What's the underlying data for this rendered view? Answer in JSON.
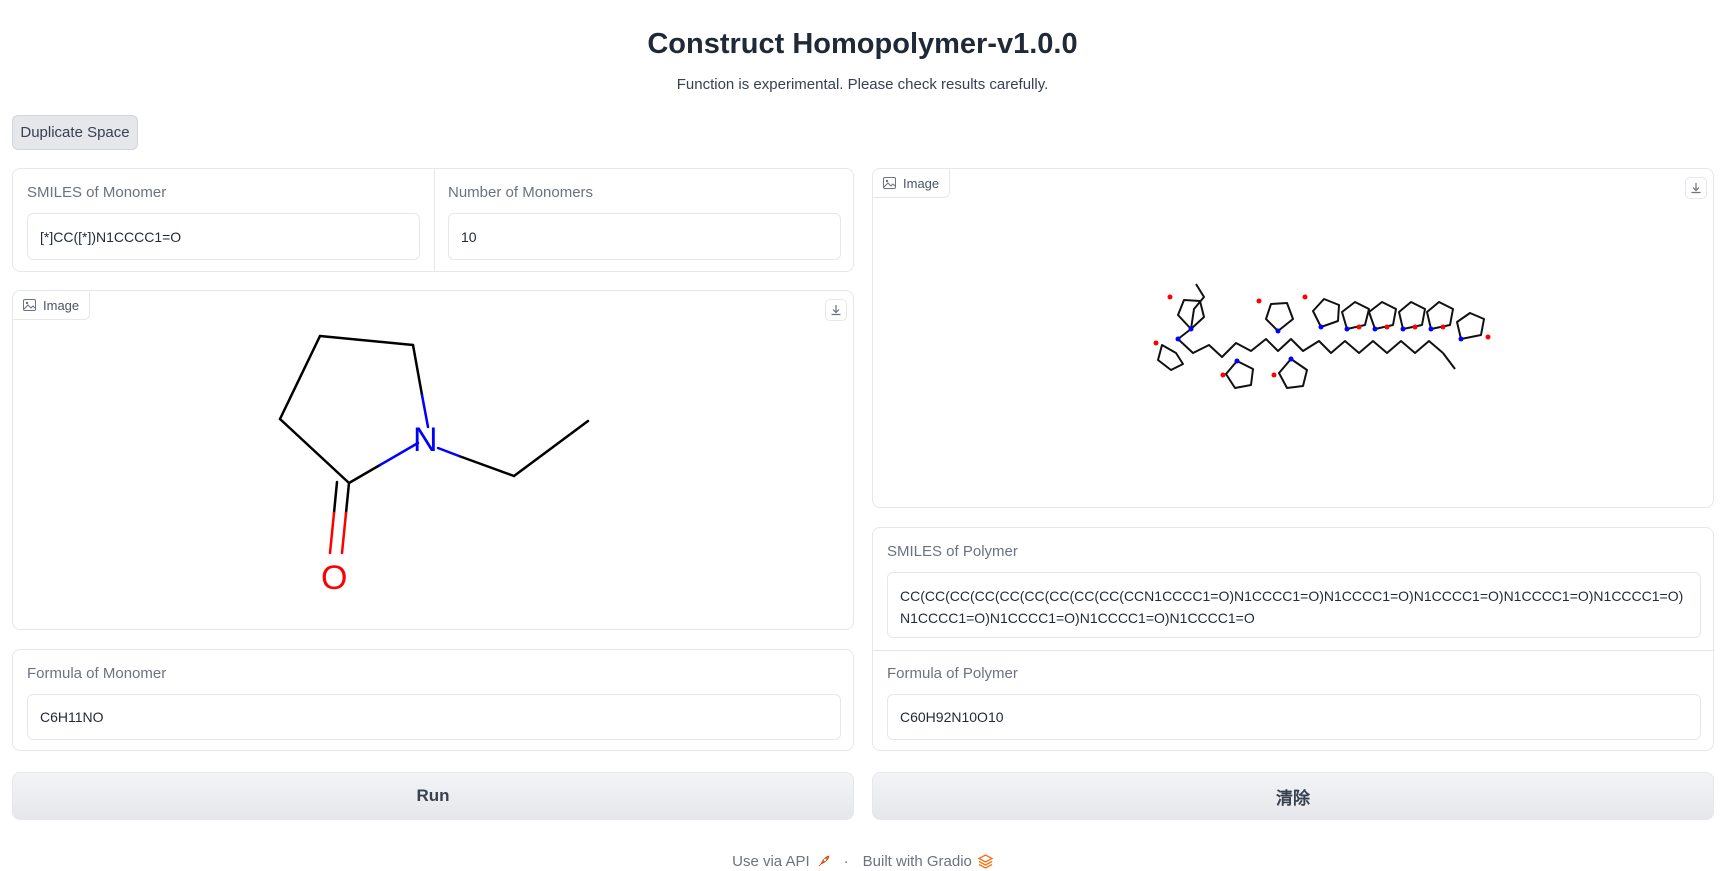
{
  "header": {
    "title": "Construct Homopolymer-v1.0.0",
    "subtitle": "Function is experimental. Please check results carefully."
  },
  "duplicate_button": "Duplicate Space",
  "monomer": {
    "smiles_label": "SMILES of Monomer",
    "smiles_value": "[*]CC([*])N1CCCC1=O",
    "count_label": "Number of Monomers",
    "count_value": "10",
    "image_label": "Image",
    "atom_n": "N",
    "atom_o": "O",
    "formula_label": "Formula of Monomer",
    "formula_value": "C6H11NO"
  },
  "polymer": {
    "image_label": "Image",
    "smiles_label": "SMILES of Polymer",
    "smiles_value": "CC(CC(CC(CC(CC(CC(CC(CC(CC(CCN1CCCC1=O)N1CCCC1=O)N1CCCC1=O)N1CCCC1=O)N1CCCC1=O)N1CCCC1=O)N1CCCC1=O)N1CCCC1=O)N1CCCC1=O)N1CCCC1=O",
    "formula_label": "Formula of Polymer",
    "formula_value": "C60H92N10O10"
  },
  "buttons": {
    "run": "Run",
    "clear": "清除"
  },
  "footer": {
    "api": "Use via API",
    "separator": "·",
    "built": "Built with Gradio"
  },
  "colors": {
    "nitrogen": "#0000ff",
    "oxygen": "#ff0000",
    "accent": "#f97316"
  }
}
